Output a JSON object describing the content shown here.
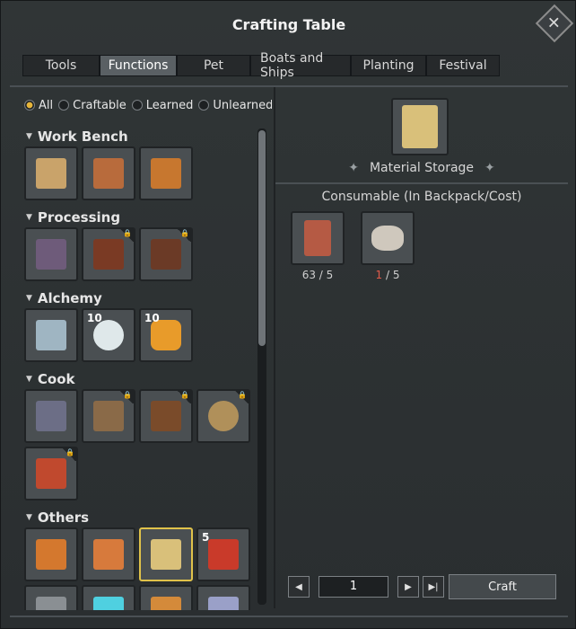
{
  "window": {
    "title": "Crafting Table"
  },
  "tabs": [
    {
      "label": "Tools",
      "active": false
    },
    {
      "label": "Functions",
      "active": true
    },
    {
      "label": "Pet",
      "active": false
    },
    {
      "label": "Boats and Ships",
      "active": false
    },
    {
      "label": "Planting",
      "active": false
    },
    {
      "label": "Festival",
      "active": false
    }
  ],
  "filters": [
    {
      "label": "All",
      "selected": true
    },
    {
      "label": "Craftable",
      "selected": false
    },
    {
      "label": "Learned",
      "selected": false
    },
    {
      "label": "Unlearned",
      "selected": false
    }
  ],
  "categories": [
    {
      "name": "Work Bench",
      "items": [
        {
          "icon": "workbench-icon",
          "locked": false,
          "count": ""
        },
        {
          "icon": "workbench-tools-icon",
          "locked": false,
          "count": ""
        },
        {
          "icon": "sawbench-icon",
          "locked": false,
          "count": ""
        }
      ]
    },
    {
      "name": "Processing",
      "items": [
        {
          "icon": "furnace-icon",
          "locked": false,
          "count": ""
        },
        {
          "icon": "loom-icon",
          "locked": true,
          "count": ""
        },
        {
          "icon": "press-icon",
          "locked": true,
          "count": ""
        }
      ]
    },
    {
      "name": "Alchemy",
      "items": [
        {
          "icon": "alchemy-station-icon",
          "locked": false,
          "count": ""
        },
        {
          "icon": "glass-bottle-icon",
          "locked": false,
          "count": "10"
        },
        {
          "icon": "jar-icon",
          "locked": false,
          "count": "10"
        }
      ]
    },
    {
      "name": "Cook",
      "items": [
        {
          "icon": "stove-icon",
          "locked": false,
          "count": ""
        },
        {
          "icon": "cook-table-icon",
          "locked": true,
          "count": ""
        },
        {
          "icon": "barrel-rack-icon",
          "locked": true,
          "count": ""
        },
        {
          "icon": "pot-icon",
          "locked": true,
          "count": ""
        },
        {
          "icon": "oven-icon",
          "locked": true,
          "count": ""
        }
      ]
    },
    {
      "name": "Others",
      "items": [
        {
          "icon": "chest-icon",
          "locked": false,
          "count": ""
        },
        {
          "icon": "mailbox-icon",
          "locked": false,
          "count": ""
        },
        {
          "icon": "wardrobe-icon",
          "locked": false,
          "count": "",
          "selected": true
        },
        {
          "icon": "firework-icon",
          "locked": false,
          "count": "5"
        }
      ]
    }
  ],
  "preview": {
    "icon": "wardrobe-icon",
    "name": "Material Storage"
  },
  "consumable": {
    "title": "Consumable (In Backpack/Cost)",
    "materials": [
      {
        "icon": "brick-icon",
        "have": "63",
        "cost": "5",
        "sufficient": true
      },
      {
        "icon": "stone-icon",
        "have": "1",
        "cost": "5",
        "sufficient": false
      }
    ]
  },
  "pager": {
    "value": "1"
  },
  "craft_button": "Craft",
  "colors": {
    "accent": "#e0c24a",
    "warning": "#e05a4a"
  }
}
